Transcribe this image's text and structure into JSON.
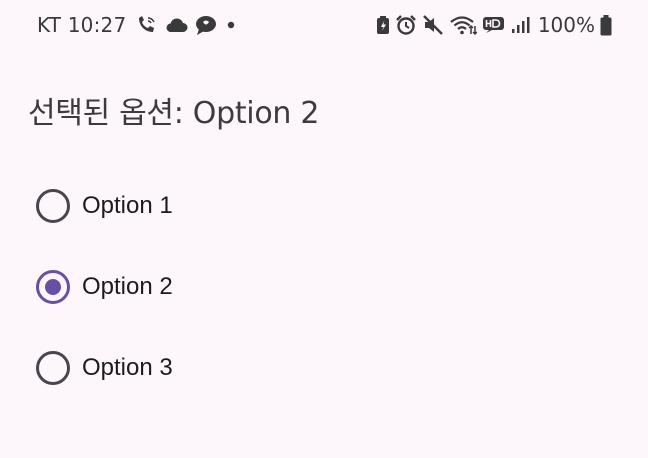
{
  "status_bar": {
    "carrier": "KT",
    "time": "10:27",
    "battery_percent": "100%",
    "left_icons": [
      "wifi-calling-icon",
      "cloud-icon",
      "chat-bubble-icon",
      "notification-dot-icon"
    ],
    "right_icons": [
      "battery-saver-icon",
      "alarm-icon",
      "mute-icon",
      "wifi-icon",
      "hd-voice-icon",
      "signal-icon",
      "battery-icon"
    ]
  },
  "header": {
    "selected_text": "선택된 옵션: Option 2"
  },
  "radio_group": {
    "selected": "Option 2",
    "options": [
      {
        "label": "Option 1",
        "checked": false
      },
      {
        "label": "Option 2",
        "checked": true
      },
      {
        "label": "Option 3",
        "checked": false
      }
    ]
  },
  "colors": {
    "background": "#FDF7FC",
    "accent": "#6750A4",
    "radio_unchecked": "#49454F",
    "text": "#1C1B1F"
  }
}
